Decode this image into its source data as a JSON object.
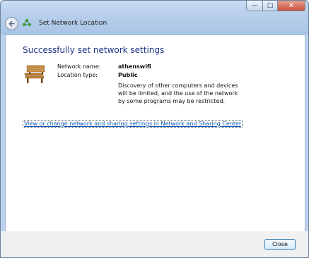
{
  "window": {
    "title": "Set Network Location",
    "caption": {
      "minimize": "—",
      "maximize": "□",
      "close": "✕"
    }
  },
  "content": {
    "heading": "Successfully set network settings",
    "network_name_label": "Network name:",
    "network_name_value": "athenswifi",
    "location_type_label": "Location type:",
    "location_type_value": "Public",
    "description": "Discovery of other computers and devices will be limited, and the use of the network by some programs may be restricted.",
    "link": "View or change network and sharing settings in Network and Sharing Center"
  },
  "footer": {
    "close_label": "Close"
  },
  "icons": {
    "back": "back-arrow-icon",
    "network": "network-icon",
    "location": "park-bench-icon"
  },
  "colors": {
    "heading": "#1e3287",
    "link": "#0a56b8"
  }
}
